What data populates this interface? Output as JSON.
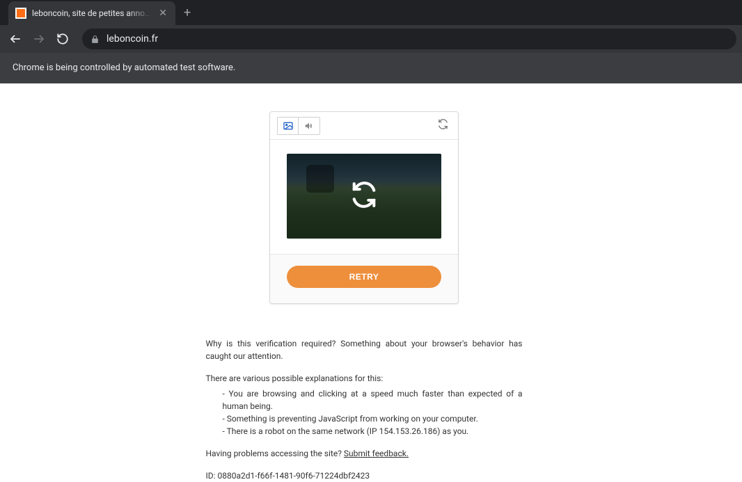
{
  "browser": {
    "tab_title": "leboncoin, site de petites annonces",
    "url": "leboncoin.fr",
    "automation_banner": "Chrome is being controlled by automated test software.",
    "favicon_color": "#ff6e14"
  },
  "captcha": {
    "retry_label": "RETRY"
  },
  "explanation": {
    "para1": "Why is this verification required? Something about your browser's behavior has caught our attention.",
    "para2": "There are various possible explanations for this:",
    "bullets": {
      "b1": "You are browsing and clicking at a speed much faster than expected of a human being.",
      "b2": "Something is preventing JavaScript from working on your computer.",
      "b3": "There is a robot on the same network (IP 154.153.26.186) as you."
    },
    "problems_prefix": "Having problems accessing the site? ",
    "feedback_link": "Submit feedback.",
    "id_prefix": "ID: ",
    "id_value": "0880a2d1-f66f-1481-90f6-71224dbf2423"
  }
}
